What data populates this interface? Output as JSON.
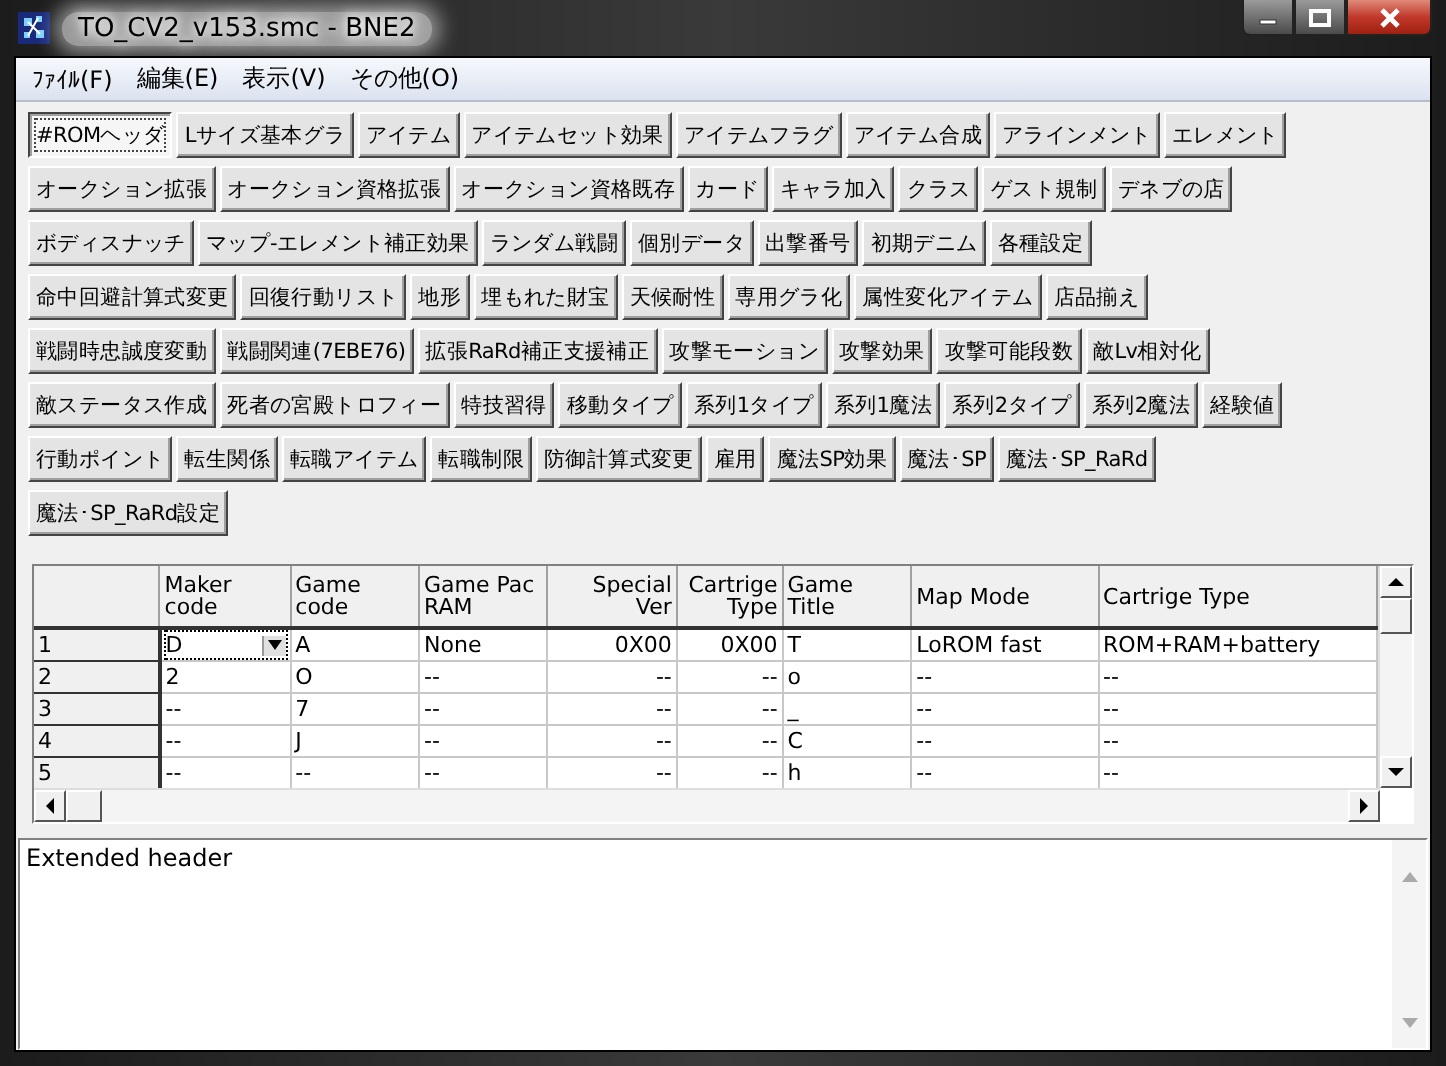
{
  "window": {
    "title": "TO_CV2_v153.smc - BNE2"
  },
  "menu": [
    {
      "label": "ﾌｧｲﾙ(F)"
    },
    {
      "label": "編集(E)"
    },
    {
      "label": "表示(V)"
    },
    {
      "label": "その他(O)"
    }
  ],
  "tab_rows": [
    [
      {
        "label": "#ROMヘッダ",
        "selected": true
      },
      {
        "label": "Lサイズ基本グラ",
        "selected": false
      },
      {
        "label": "アイテム",
        "selected": false
      },
      {
        "label": "アイテムセット効果",
        "selected": false
      },
      {
        "label": "アイテムフラグ",
        "selected": false
      },
      {
        "label": "アイテム合成",
        "selected": false
      },
      {
        "label": "アラインメント",
        "selected": false
      },
      {
        "label": "エレメント",
        "selected": false
      }
    ],
    [
      {
        "label": "オークション拡張",
        "selected": false
      },
      {
        "label": "オークション資格拡張",
        "selected": false
      },
      {
        "label": "オークション資格既存",
        "selected": false
      },
      {
        "label": "カード",
        "selected": false
      },
      {
        "label": "キャラ加入",
        "selected": false
      },
      {
        "label": "クラス",
        "selected": false
      },
      {
        "label": "ゲスト規制",
        "selected": false
      },
      {
        "label": "デネブの店",
        "selected": false
      }
    ],
    [
      {
        "label": "ボディスナッチ",
        "selected": false
      },
      {
        "label": "マップ-エレメント補正効果",
        "selected": false
      },
      {
        "label": "ランダム戦闘",
        "selected": false
      },
      {
        "label": "個別データ",
        "selected": false
      },
      {
        "label": "出撃番号",
        "selected": false
      },
      {
        "label": "初期デニム",
        "selected": false
      },
      {
        "label": "各種設定",
        "selected": false
      }
    ],
    [
      {
        "label": "命中回避計算式変更",
        "selected": false
      },
      {
        "label": "回復行動リスト",
        "selected": false
      },
      {
        "label": "地形",
        "selected": false
      },
      {
        "label": "埋もれた財宝",
        "selected": false
      },
      {
        "label": "天候耐性",
        "selected": false
      },
      {
        "label": "専用グラ化",
        "selected": false
      },
      {
        "label": "属性変化アイテム",
        "selected": false
      },
      {
        "label": "店品揃え",
        "selected": false
      }
    ],
    [
      {
        "label": "戦闘時忠誠度変動",
        "selected": false
      },
      {
        "label": "戦闘関連(7EBE76)",
        "selected": false
      },
      {
        "label": "拡張RaRd補正支援補正",
        "selected": false
      },
      {
        "label": "攻撃モーション",
        "selected": false
      },
      {
        "label": "攻撃効果",
        "selected": false
      },
      {
        "label": "攻撃可能段数",
        "selected": false
      },
      {
        "label": "敵Lv相対化",
        "selected": false
      }
    ],
    [
      {
        "label": "敵ステータス作成",
        "selected": false
      },
      {
        "label": "死者の宮殿トロフィー",
        "selected": false
      },
      {
        "label": "特技習得",
        "selected": false
      },
      {
        "label": "移動タイプ",
        "selected": false
      },
      {
        "label": "系列1タイプ",
        "selected": false
      },
      {
        "label": "系列1魔法",
        "selected": false
      },
      {
        "label": "系列2タイプ",
        "selected": false
      },
      {
        "label": "系列2魔法",
        "selected": false
      },
      {
        "label": "経験値",
        "selected": false
      }
    ],
    [
      {
        "label": "行動ポイント",
        "selected": false
      },
      {
        "label": "転生関係",
        "selected": false
      },
      {
        "label": "転職アイテム",
        "selected": false
      },
      {
        "label": "転職制限",
        "selected": false
      },
      {
        "label": "防御計算式変更",
        "selected": false
      },
      {
        "label": "雇用",
        "selected": false
      },
      {
        "label": "魔法SP効果",
        "selected": false
      },
      {
        "label": "魔法･SP",
        "selected": false
      },
      {
        "label": "魔法･SP_RaRd",
        "selected": false
      }
    ],
    [
      {
        "label": "魔法･SP_RaRd設定",
        "selected": false
      }
    ]
  ],
  "table": {
    "columns": [
      {
        "label": "Maker code",
        "kind": "text"
      },
      {
        "label": "Game code",
        "kind": "text"
      },
      {
        "label": "Game Pac RAM",
        "kind": "text"
      },
      {
        "label": "Special Ver",
        "kind": "number"
      },
      {
        "label": "Cartrige Type",
        "kind": "number"
      },
      {
        "label": "Game Title",
        "kind": "text"
      },
      {
        "label": "Map Mode",
        "kind": "text"
      },
      {
        "label": "Cartrige Type",
        "kind": "text"
      }
    ],
    "rows": [
      {
        "header": "1",
        "cells": [
          {
            "text": "D",
            "kind": "dropdown"
          },
          "A",
          "None",
          "0X00",
          "0X00",
          "T",
          "LoROM fast",
          "ROM+RAM+battery"
        ]
      },
      {
        "header": "2",
        "cells": [
          "2",
          "O",
          "--",
          "--",
          "--",
          "o",
          "--",
          "--"
        ]
      },
      {
        "header": "3",
        "cells": [
          "--",
          "7",
          "--",
          "--",
          "--",
          "_",
          "--",
          "--"
        ]
      },
      {
        "header": "4",
        "cells": [
          "--",
          "J",
          "--",
          "--",
          "--",
          "C",
          "--",
          "--"
        ]
      },
      {
        "header": "5",
        "cells": [
          "--",
          "--",
          "--",
          "--",
          "--",
          "h",
          "--",
          "--"
        ]
      }
    ]
  },
  "description": {
    "text": "Extended header"
  }
}
